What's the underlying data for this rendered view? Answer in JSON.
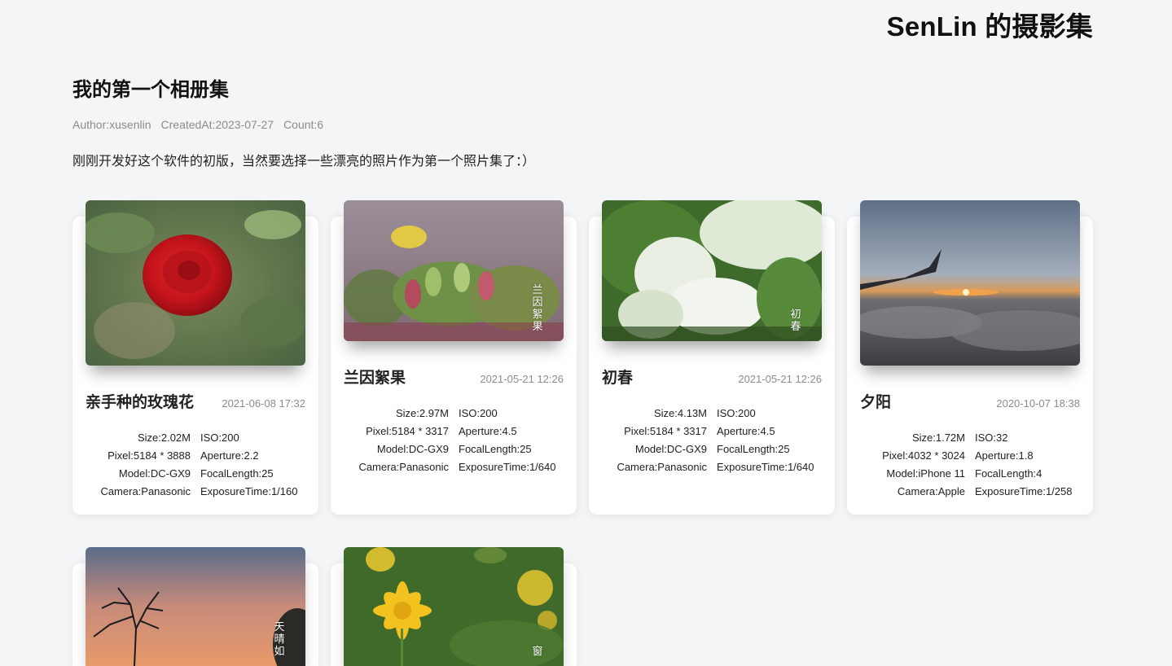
{
  "site": {
    "title": "SenLin 的摄影集"
  },
  "album": {
    "title": "我的第一个相册集",
    "author": "Author:xusenlin",
    "created": "CreatedAt:2023-07-27",
    "count": "Count:6",
    "description": "刚刚开发好这个软件的初版，当然要选择一些漂亮的照片作为第一个照片集了：）"
  },
  "photos": [
    {
      "name": "亲手种的玫瑰花",
      "date": "2021-06-08 17:32",
      "size": "Size:2.02M",
      "iso": "ISO:200",
      "pixel": "Pixel:5184 * 3888",
      "aperture": "Aperture:2.2",
      "model": "Model:DC-GX9",
      "focal": "FocalLength:25",
      "camera": "Camera:Panasonic",
      "exposure": "ExposureTime:1/160",
      "overlay": ""
    },
    {
      "name": "兰因絮果",
      "date": "2021-05-21 12:26",
      "size": "Size:2.97M",
      "iso": "ISO:200",
      "pixel": "Pixel:5184 * 3317",
      "aperture": "Aperture:4.5",
      "model": "Model:DC-GX9",
      "focal": "FocalLength:25",
      "camera": "Camera:Panasonic",
      "exposure": "ExposureTime:1/640",
      "overlay": "兰因絮果"
    },
    {
      "name": "初春",
      "date": "2021-05-21 12:26",
      "size": "Size:4.13M",
      "iso": "ISO:200",
      "pixel": "Pixel:5184 * 3317",
      "aperture": "Aperture:4.5",
      "model": "Model:DC-GX9",
      "focal": "FocalLength:25",
      "camera": "Camera:Panasonic",
      "exposure": "ExposureTime:1/640",
      "overlay": "初春"
    },
    {
      "name": "夕阳",
      "date": "2020-10-07 18:38",
      "size": "Size:1.72M",
      "iso": "ISO:32",
      "pixel": "Pixel:4032 * 3024",
      "aperture": "Aperture:1.8",
      "model": "Model:iPhone 11",
      "focal": "FocalLength:4",
      "camera": "Camera:Apple",
      "exposure": "ExposureTime:1/258",
      "overlay": ""
    },
    {
      "overlay": "天晴如"
    },
    {
      "overlay": "窗"
    }
  ]
}
